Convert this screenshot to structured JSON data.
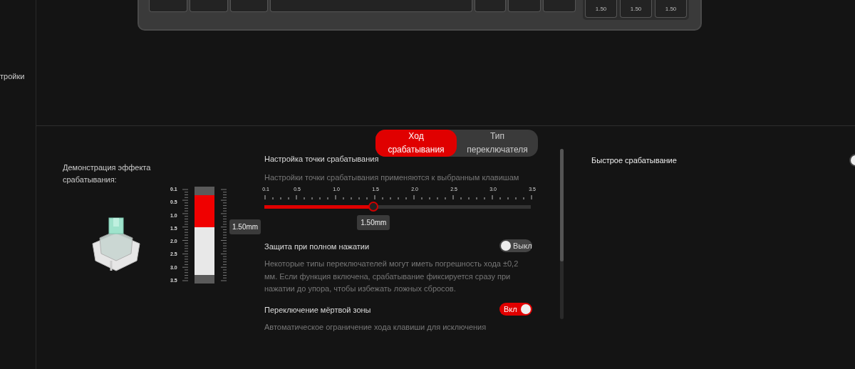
{
  "sidebar": {
    "items": [
      {
        "label": "тройки"
      }
    ]
  },
  "keyboard": {
    "cluster_keys": [
      {
        "label": "1.50"
      },
      {
        "label": "1.50"
      },
      {
        "label": "1.50"
      }
    ]
  },
  "tabs": [
    {
      "label": "Ход срабатывания",
      "selected": true
    },
    {
      "label": "Тип переключателя",
      "selected": false
    }
  ],
  "demo": {
    "title": "Демонстрация эффекта срабатывания:",
    "scale": [
      "0.1",
      "0.5",
      "1.0",
      "1.5",
      "2.0",
      "2.5",
      "3.0",
      "3.5"
    ],
    "level": 0.42,
    "reading": "1.50mm"
  },
  "actuation": {
    "title": "Настройка точки срабатывания",
    "description": "Настройки точки срабатывания применяются к выбранным клавишам",
    "scale": [
      "0.1",
      "0.5",
      "1.0",
      "1.5",
      "2.0",
      "2.5",
      "3.0",
      "3.5"
    ],
    "level": 0.41,
    "reading": "1.50mm"
  },
  "settings": [
    {
      "title": "Защита при полном нажатии",
      "toggle": {
        "on": false,
        "label": "Выкл"
      },
      "description": "Некоторые типы переключателей могут иметь погрешность хода ±0,2 мм. Если функция включена, срабатывание фиксируется сразу при нажатии до упора, чтобы избежать ложных сбросов."
    },
    {
      "title": "Переключение мёртвой зоны",
      "toggle": {
        "on": true,
        "label": "Вкл"
      },
      "description": "Автоматическое ограничение хода клавиши для исключения"
    }
  ],
  "right_panel": {
    "title": "Быстрое срабатывание",
    "on": false
  }
}
